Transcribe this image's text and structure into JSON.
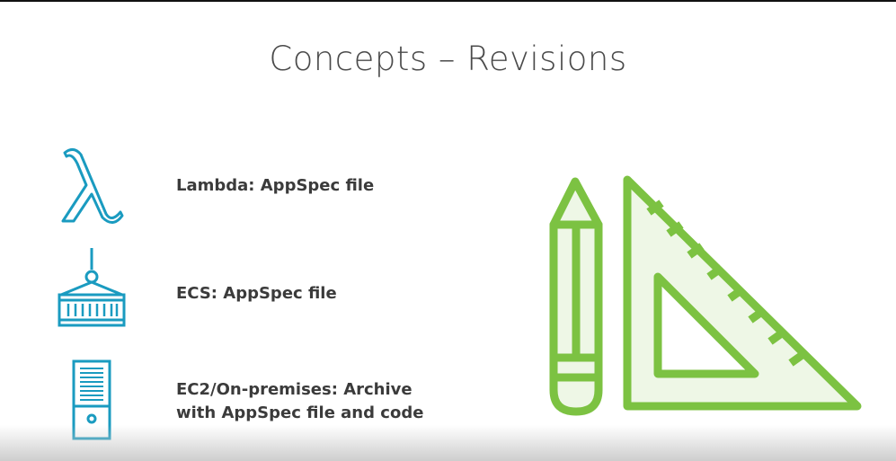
{
  "slide": {
    "title": "Concepts – Revisions",
    "items": [
      {
        "icon": "lambda-icon",
        "text": "Lambda: AppSpec file"
      },
      {
        "icon": "container-icon",
        "text": "ECS: AppSpec file"
      },
      {
        "icon": "server-icon",
        "line1": "EC2/On-premises: Archive",
        "line2": "with AppSpec file and code"
      }
    ],
    "illustration": "pencil-and-set-square-icon"
  },
  "colors": {
    "icon_blue": "#1a9bc0",
    "icon_green": "#7cc242",
    "green_fill": "#eef7e6",
    "text": "#3b3b3b"
  }
}
